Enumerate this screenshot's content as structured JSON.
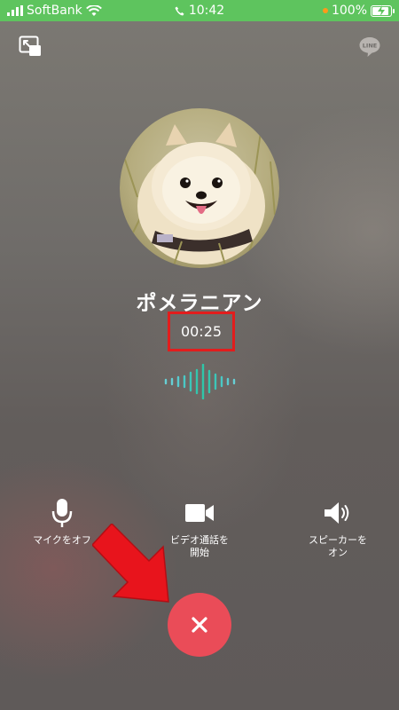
{
  "status_bar": {
    "carrier": "SoftBank",
    "time": "10:42",
    "battery": "100%",
    "bg_color": "#5ec45e"
  },
  "call": {
    "contact_name": "ポメラニアン",
    "duration": "00:25"
  },
  "controls": {
    "mic_label": "マイクをオフ",
    "video_label_line1": "ビデオ通話を",
    "video_label_line2": "開始",
    "speaker_label_line1": "スピーカーを",
    "speaker_label_line2": "オン"
  },
  "top_icons": {
    "pip_icon": "picture-in-picture-icon",
    "line_icon": "line-logo-icon",
    "line_logo_text": "LINE"
  },
  "colors": {
    "end_call": "#ea4c58",
    "highlight_box": "#e21d1d",
    "annotation_arrow": "#e8141c",
    "wave": "#2fc6a8"
  }
}
